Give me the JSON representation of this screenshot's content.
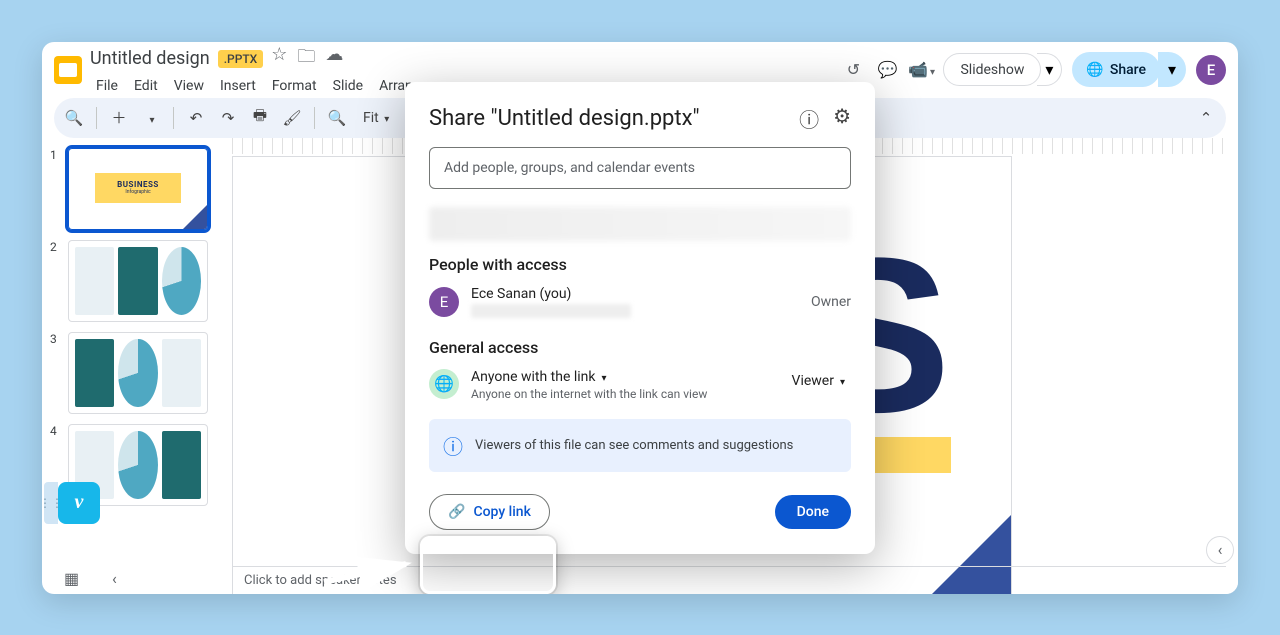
{
  "doc": {
    "title": "Untitled design",
    "badge": ".PPTX"
  },
  "menus": [
    "File",
    "Edit",
    "View",
    "Insert",
    "Format",
    "Slide",
    "Arrange"
  ],
  "toolbar": {
    "zoom": "Fit"
  },
  "topbar": {
    "slideshow": "Slideshow",
    "share": "Share",
    "avatar_initial": "E"
  },
  "thumbs": [
    {
      "n": "1",
      "title": "BUSINESS",
      "subtitle": "Infographic"
    },
    {
      "n": "2"
    },
    {
      "n": "3"
    },
    {
      "n": "4"
    }
  ],
  "canvas": {
    "big_letter": "S"
  },
  "notes": {
    "placeholder": "Click to add speaker notes"
  },
  "modal": {
    "title": "Share \"Untitled design.pptx\"",
    "add_placeholder": "Add people, groups, and calendar events",
    "people_section": "People with access",
    "person": {
      "name": "Ece Sanan (you)",
      "role": "Owner",
      "initial": "E"
    },
    "general_section": "General access",
    "link_scope": "Anyone with the link",
    "link_desc": "Anyone on the internet with the link can view",
    "viewer_label": "Viewer",
    "info_text": "Viewers of this file can see comments and suggestions",
    "copy_link": "Copy link",
    "done": "Done"
  },
  "floating": {
    "glyph": "v"
  }
}
